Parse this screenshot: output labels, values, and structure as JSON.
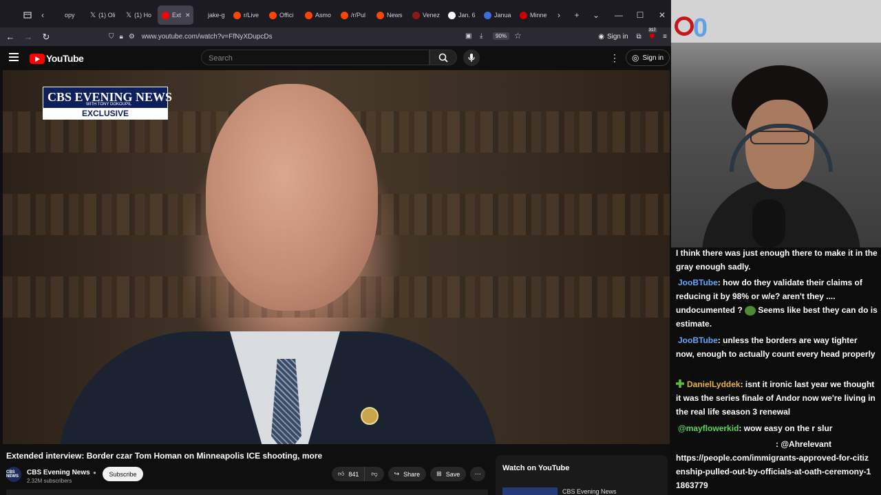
{
  "browser": {
    "tabs": [
      {
        "label": "opy",
        "favicon_color": "#cfcfd8"
      },
      {
        "label": "(1) Oli",
        "favicon_color": "#ffffff"
      },
      {
        "label": "(1) Ho",
        "favicon_color": "#ffffff"
      },
      {
        "label": "Ext",
        "favicon_color": "#ff0000",
        "active": true
      },
      {
        "label": "jake-g",
        "favicon_color": "#888888"
      },
      {
        "label": "r/Live",
        "favicon_color": "#ff4500"
      },
      {
        "label": "Offici",
        "favicon_color": "#ff4500"
      },
      {
        "label": "Asmo",
        "favicon_color": "#ff4500"
      },
      {
        "label": "/r/Pul",
        "favicon_color": "#ff4500"
      },
      {
        "label": "News",
        "favicon_color": "#ff4500"
      },
      {
        "label": "Venez",
        "favicon_color": "#8b1a1a"
      },
      {
        "label": "Jan. 6",
        "favicon_color": "#ffffff"
      },
      {
        "label": "Janua",
        "favicon_color": "#3b6fd8"
      },
      {
        "label": "Minne",
        "favicon_color": "#cc0000"
      }
    ],
    "url": "www.youtube.com/watch?v=FfNyXDupcDs",
    "zoom": "90%",
    "signin_label": "Sign in",
    "extension_badge": "317"
  },
  "youtube": {
    "logo_text": "YouTube",
    "search_placeholder": "Search",
    "signin_label": "Sign in"
  },
  "video": {
    "badge_top": "CBS EVENING NEWS",
    "badge_sub": "WITH TONY DOKOUPIL",
    "badge_exclusive": "EXCLUSIVE",
    "title": "Extended interview: Border czar Tom Homan on Minneapolis ICE shooting, more",
    "channel_name": "CBS Evening News",
    "channel_avatar_text": "CBS NEWS",
    "subscribers": "2.32M subscribers",
    "subscribe_label": "Subscribe",
    "likes": "841",
    "share_label": "Share",
    "save_label": "Save"
  },
  "watch_panel": {
    "title": "Watch on YouTube",
    "channel": "CBS Evening News"
  },
  "stream_overlay": {
    "counter": "0"
  },
  "chat": [
    {
      "user": "",
      "color": "#ffffff",
      "text": "I think there was just enough there to make it in the gray enough sadly."
    },
    {
      "user": "JooBTube",
      "color": "#5fa8ff",
      "text": ": how do they validate their claims of reducing it by 98% or w/e? aren't they .... undocumented ?",
      "emote": "face-emote",
      "text2": " Seems like best they can do is estimate."
    },
    {
      "user": "JooBTube",
      "color": "#5fa8ff",
      "text": ": unless the borders are way tighter now, enough to actually count every head properly"
    },
    {
      "user": "DanielLyddek",
      "color": "#e8b23a",
      "text": ": isnt it ironic last year we thought it was the series finale of Andor now we're living in the real life season 3 renewal"
    },
    {
      "user": "@mayflowerkid",
      "color": "#5cd65c",
      "text": ": wow easy on the r slur"
    },
    {
      "user": "",
      "color": "#ffffff",
      "text": ": @Ahrelevant https://people.com/immigrants-approved-for-citizenship-pulled-out-by-officials-at-oath-ceremony-11863779"
    }
  ]
}
